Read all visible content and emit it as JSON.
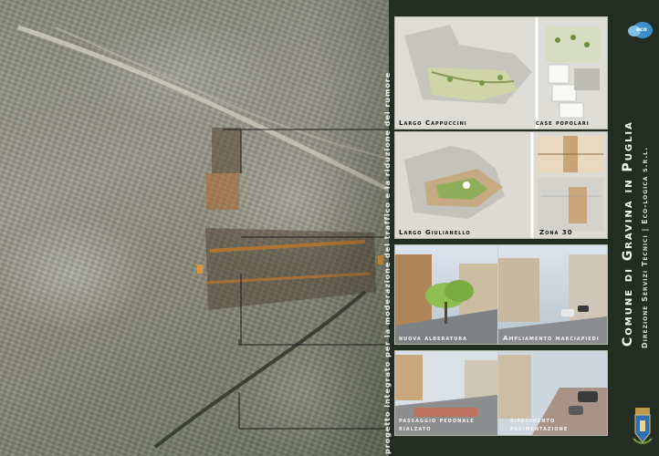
{
  "title": "Comune di Gravina in Puglia",
  "subtitle": "Direzione Servizi Tecnici | Eco-logica s.r.l.",
  "project": "progetto integrato per la moderazione del traffico e la riduzione del rumore",
  "logo_text": "eco",
  "panels": {
    "largo_cappuccini": "Largo Cappuccini",
    "case_popolari": "case popolari",
    "largo_giulianello": "Largo Giulianello",
    "zona_30": "Zona 30",
    "nuova_alberatura": "nuova alberatura",
    "ampliamento_marciapiedi": "Ampliamento marciapiedi",
    "passaggio_pedonale": "passaggio pedonale",
    "rialzato": "rialzato",
    "rifacimento": "rifacimento",
    "pavimentazione": "pavimentazione"
  },
  "colors": {
    "panel_bg": "#232d22",
    "card_bg": "#e6e6e1",
    "map_highlight": "#c77a2c",
    "road": "#f2f0e8"
  }
}
